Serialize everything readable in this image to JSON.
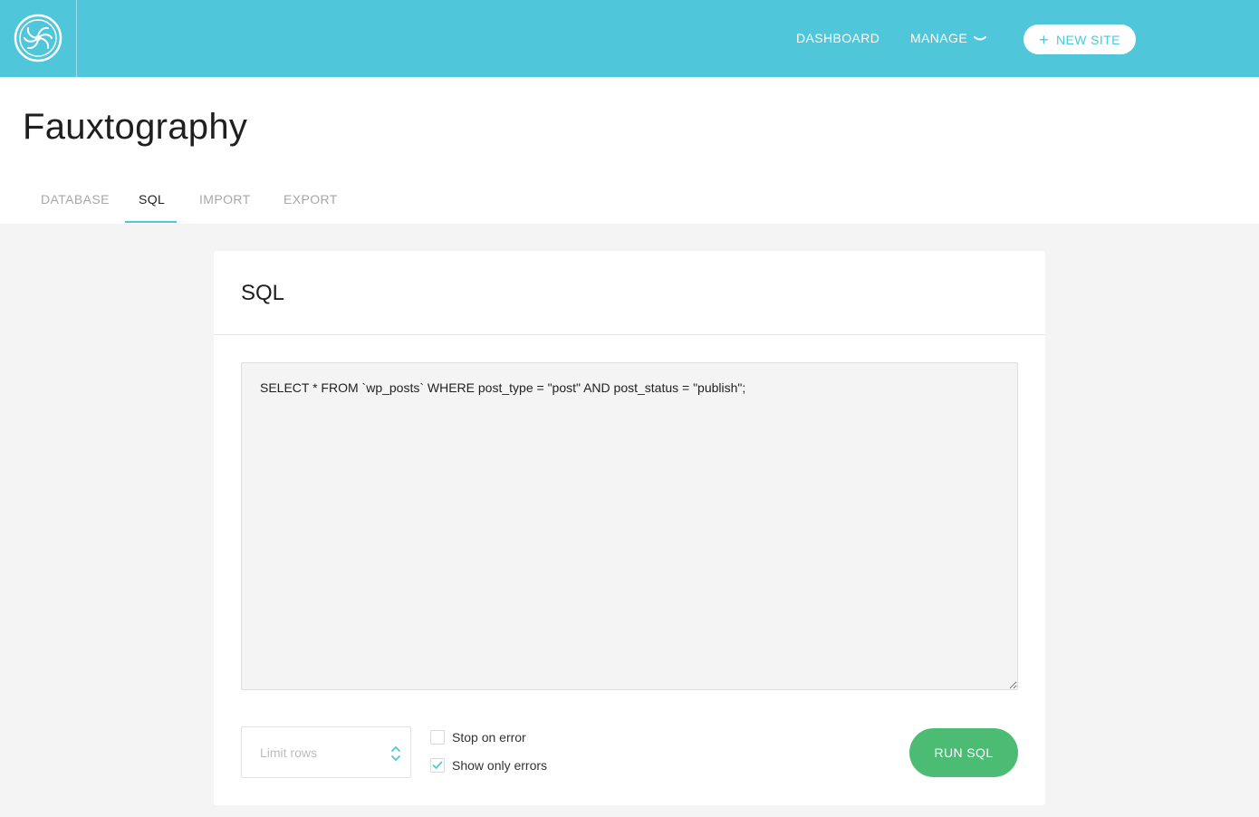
{
  "topbar": {
    "logo_icon": "flywheel-logo-icon",
    "nav": [
      {
        "label": "DASHBOARD"
      },
      {
        "label": "MANAGE"
      }
    ],
    "manage_chevron_icon": "chevron-down-icon",
    "new_site_plus": "+",
    "new_site_label": "NEW SITE"
  },
  "page": {
    "title": "Fauxtography",
    "tabs": [
      {
        "label": "DATABASE",
        "active": false
      },
      {
        "label": "SQL",
        "active": true
      },
      {
        "label": "IMPORT",
        "active": false
      },
      {
        "label": "EXPORT",
        "active": false
      }
    ]
  },
  "sql_card": {
    "title": "SQL",
    "query": "SELECT * FROM `wp_posts` WHERE post_type = \"post\" AND post_status = \"publish\";",
    "limit_rows_placeholder": "Limit rows",
    "stop_on_error": {
      "label": "Stop on error",
      "checked": false
    },
    "show_only_errors": {
      "label": "Show only errors",
      "checked": true
    },
    "run_label": "RUN SQL"
  },
  "colors": {
    "brand": "#50c6db",
    "run_button": "#4cbb73",
    "background": "#f5f4f4"
  }
}
